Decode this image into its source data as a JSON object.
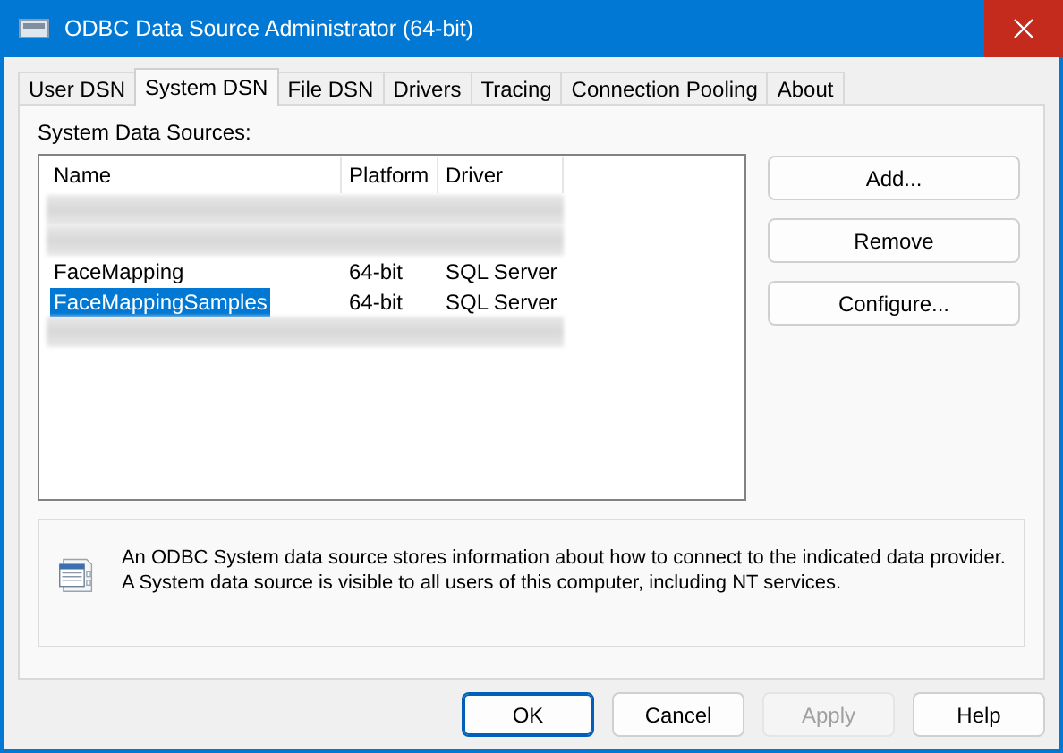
{
  "window": {
    "title": "ODBC Data Source Administrator (64-bit)"
  },
  "tabs": [
    {
      "label": "User DSN",
      "selected": false
    },
    {
      "label": "System DSN",
      "selected": true
    },
    {
      "label": "File DSN",
      "selected": false
    },
    {
      "label": "Drivers",
      "selected": false
    },
    {
      "label": "Tracing",
      "selected": false
    },
    {
      "label": "Connection Pooling",
      "selected": false
    },
    {
      "label": "About",
      "selected": false
    }
  ],
  "list": {
    "label": "System Data Sources:",
    "columns": [
      "Name",
      "Platform",
      "Driver"
    ],
    "rows": [
      {
        "kind": "redacted"
      },
      {
        "kind": "redacted"
      },
      {
        "kind": "entry",
        "name": "FaceMapping",
        "platform": "64-bit",
        "driver": "SQL Server",
        "selected": false
      },
      {
        "kind": "entry",
        "name": "FaceMappingSamples",
        "platform": "64-bit",
        "driver": "SQL Server",
        "selected": true
      },
      {
        "kind": "redacted"
      }
    ]
  },
  "side_buttons": [
    "Add...",
    "Remove",
    "Configure..."
  ],
  "info": {
    "lines": [
      "An ODBC System data source stores information about how to connect to the indicated data provider.",
      "A System data source is visible to all users of this computer, including NT services."
    ]
  },
  "footer_buttons": [
    {
      "label": "OK",
      "disabled": false,
      "default": true
    },
    {
      "label": "Cancel",
      "disabled": false,
      "default": false
    },
    {
      "label": "Apply",
      "disabled": true,
      "default": false
    },
    {
      "label": "Help",
      "disabled": false,
      "default": false
    }
  ]
}
